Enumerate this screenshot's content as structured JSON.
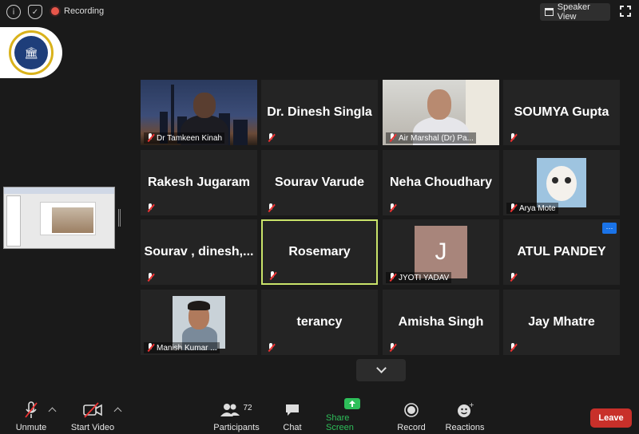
{
  "topbar": {
    "recording_label": "Recording",
    "speaker_view_label": "Speaker View"
  },
  "tiles": [
    {
      "name": "Dr Tamkeen Kinah",
      "type": "video"
    },
    {
      "name": "Dr. Dinesh Singla",
      "type": "name"
    },
    {
      "name": "Air Marshal (Dr) Pa...",
      "type": "video"
    },
    {
      "name": "SOUMYA Gupta",
      "type": "name"
    },
    {
      "name": "Rakesh Jugaram",
      "type": "name"
    },
    {
      "name": "Sourav Varude",
      "type": "name"
    },
    {
      "name": "Neha Choudhary",
      "type": "name"
    },
    {
      "name": "Arya Mote",
      "type": "avatar"
    },
    {
      "name": "Sourav , dinesh,...",
      "type": "name"
    },
    {
      "name": "Rosemary",
      "type": "name",
      "active": true
    },
    {
      "name": "JYOTI YADAV",
      "type": "letter",
      "letter": "J"
    },
    {
      "name": "ATUL PANDEY",
      "type": "name",
      "more_label": "···"
    },
    {
      "name": "Manish Kumar ...",
      "type": "avatar"
    },
    {
      "name": "terancy",
      "type": "name"
    },
    {
      "name": "Amisha Singh",
      "type": "name"
    },
    {
      "name": "Jay Mhatre",
      "type": "name"
    }
  ],
  "toolbar": {
    "unmute_label": "Unmute",
    "start_video_label": "Start Video",
    "participants_label": "Participants",
    "participants_count": "72",
    "chat_label": "Chat",
    "share_screen_label": "Share Screen",
    "record_label": "Record",
    "reactions_label": "Reactions",
    "leave_label": "Leave"
  },
  "colors": {
    "accent_green": "#2ebf5a",
    "leave_red": "#c8302a",
    "active_border": "#c9e36a",
    "letter_avatar_bg": "#a8857b"
  }
}
